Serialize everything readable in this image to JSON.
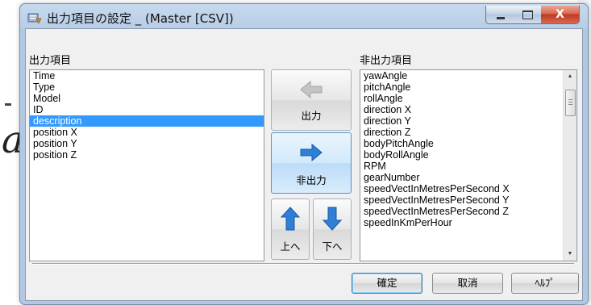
{
  "window": {
    "title": "出力項目の設定 _ (Master [CSV])",
    "close_glyph": "X"
  },
  "output_panel": {
    "label": "出力項目",
    "items": [
      "Time",
      "Type",
      "Model",
      "ID",
      "description",
      "position X",
      "position Y",
      "position Z"
    ],
    "selected": "description"
  },
  "nonoutput_panel": {
    "label": "非出力項目",
    "items": [
      "yawAngle",
      "pitchAngle",
      "rollAngle",
      "direction X",
      "direction Y",
      "direction Z",
      "bodyPitchAngle",
      "bodyRollAngle",
      "RPM",
      "gearNumber",
      "speedVectInMetresPerSecond X",
      "speedVectInMetresPerSecond Y",
      "speedVectInMetresPerSecond Z",
      "speedInKmPerHour"
    ]
  },
  "buttons": {
    "output": "出力",
    "nonoutput": "非出力",
    "move_up": "上へ",
    "move_down": "下へ",
    "ok": "確定",
    "cancel": "取消",
    "help": "ﾍﾙﾌﾟ"
  },
  "icons": {
    "app": "settings-list-icon",
    "output": "arrow-left-icon",
    "nonoutput": "arrow-right-icon",
    "up": "arrow-up-icon",
    "down": "arrow-down-icon"
  },
  "colors": {
    "selection": "#3399ff",
    "arrow_blue": "#2f7fd6",
    "arrow_gray": "#b8b8b8"
  }
}
